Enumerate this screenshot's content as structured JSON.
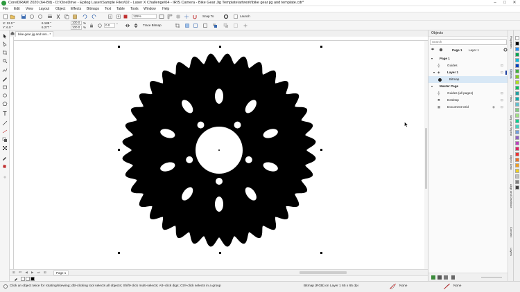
{
  "window": {
    "title": "CorelDRAW 2020 (64-Bit) - D:\\OneDrive - Epilog Laser\\Sample Files\\02 - Laser X Challenge\\04 - IRIS Camera - Bike Gear Jig Template\\artwork\\bike gear jig and template.cdr*",
    "minimize": "–",
    "maximize": "□",
    "close": "✕"
  },
  "menu": [
    "File",
    "Edit",
    "View",
    "Layout",
    "Object",
    "Effects",
    "Bitmaps",
    "Text",
    "Table",
    "Tools",
    "Window",
    "Help"
  ],
  "toolbar": {
    "zoom": "125%",
    "snap_to": "Snap To",
    "launch": "Launch"
  },
  "propbar": {
    "x": "X: 12.0 \"",
    "y": "Y: 6.0 \"",
    "w": "6.188 \"",
    "h": "6.277 \"",
    "sx": "100.0",
    "sy": "100.0",
    "pct": "%",
    "angle": "0.0",
    "deg": "°",
    "trace": "Trace Bitmap"
  },
  "document": {
    "tab": "bike gear jig and tem...*",
    "page_tab": "Page 1"
  },
  "objects_panel": {
    "title": "Objects",
    "search": "Search",
    "page_label": "Page 1",
    "layer_label": "Layer 1",
    "tree": [
      {
        "label": "Page 1",
        "bold": true
      },
      {
        "label": "Guides"
      },
      {
        "label": "Layer 1",
        "bold": true
      },
      {
        "label": "Bitmap",
        "selected": true
      },
      {
        "label": "Master Page",
        "bold": true
      },
      {
        "label": "Guides (all pages)"
      },
      {
        "label": "Desktop"
      },
      {
        "label": "Document Grid"
      }
    ]
  },
  "dockers": [
    "Properties",
    "Objects",
    "Hints",
    "Step and Repeat",
    "Object Data",
    "Align and Distribute",
    "Connect",
    "Layers"
  ],
  "status": {
    "hint": "Click an object twice for rotating/skewing; dbl-clicking tool selects all objects; Shift+click multi-selects; Alt+click digs; Ctrl+click selects in a group",
    "object": "Bitmap (RGB) on Layer 1 65 x 65 dpi",
    "fill": "None",
    "outline": "None"
  },
  "colors": {
    "palette": [
      "#ffffff",
      "#000000",
      "#1e90ff",
      "#00a651",
      "#00c0e0",
      "#0040c0",
      "#40b040",
      "#7fd020",
      "#b0e020",
      "#00c060",
      "#20a0a0",
      "#00b0b0",
      "#60c0d0",
      "#80d080",
      "#a0e080",
      "#00d090",
      "#40d0c0",
      "#70a0e0",
      "#9060c0",
      "#c040c0",
      "#e02060",
      "#f03030",
      "#f07020",
      "#f0a020",
      "#f0d020",
      "#c0c0c0",
      "#808080",
      "#404040"
    ]
  }
}
